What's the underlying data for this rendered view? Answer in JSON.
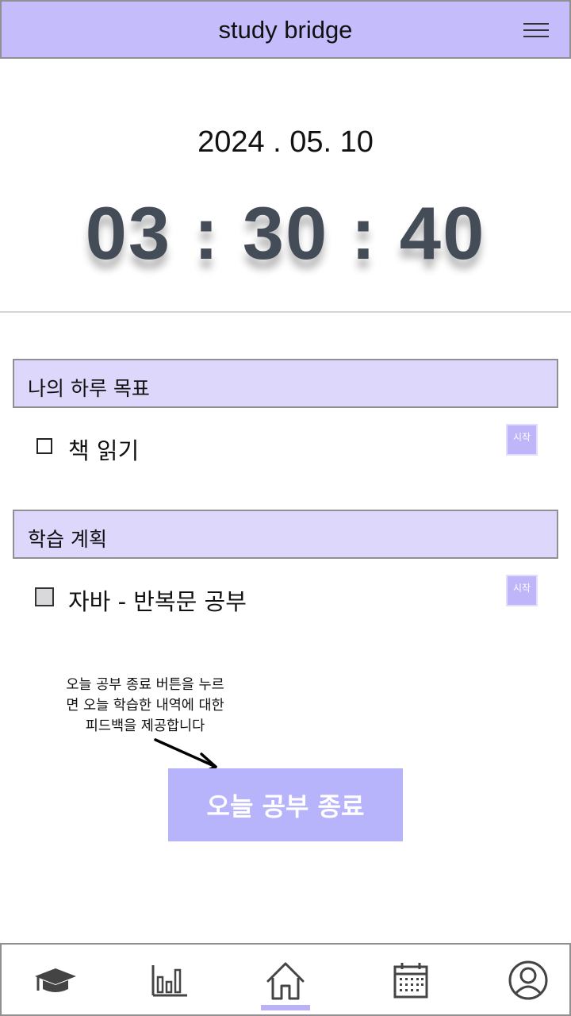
{
  "header": {
    "title": "study bridge",
    "menu_icon": "hamburger-menu-icon"
  },
  "clock": {
    "date": "2024 . 05. 10",
    "time": "03 : 30 : 40"
  },
  "sections": [
    {
      "title": "나의 하루 목표",
      "tasks": [
        {
          "label": "책 읽기",
          "checked": false,
          "start_label": "시작"
        }
      ]
    },
    {
      "title": "학습 계획",
      "tasks": [
        {
          "label": "자바 - 반복문 공부",
          "checked": false,
          "start_label": "시작"
        }
      ]
    }
  ],
  "hint": {
    "lines": [
      "오늘 공부 종료 버튼을 누르",
      "면 오늘 학습한 내역에 대한",
      "피드백을 제공합니다"
    ]
  },
  "finish_button": {
    "label": "오늘 공부 종료"
  },
  "bottom_nav": {
    "items": [
      {
        "icon": "graduation-cap-icon"
      },
      {
        "icon": "bar-chart-icon"
      },
      {
        "icon": "home-icon",
        "active": true
      },
      {
        "icon": "calendar-icon"
      },
      {
        "icon": "user-profile-icon"
      }
    ]
  },
  "colors": {
    "header_bg": "#c4bcfb",
    "section_bg": "#dcd7fb",
    "accent": "#b8b4fb",
    "timer_text": "#444c57"
  }
}
